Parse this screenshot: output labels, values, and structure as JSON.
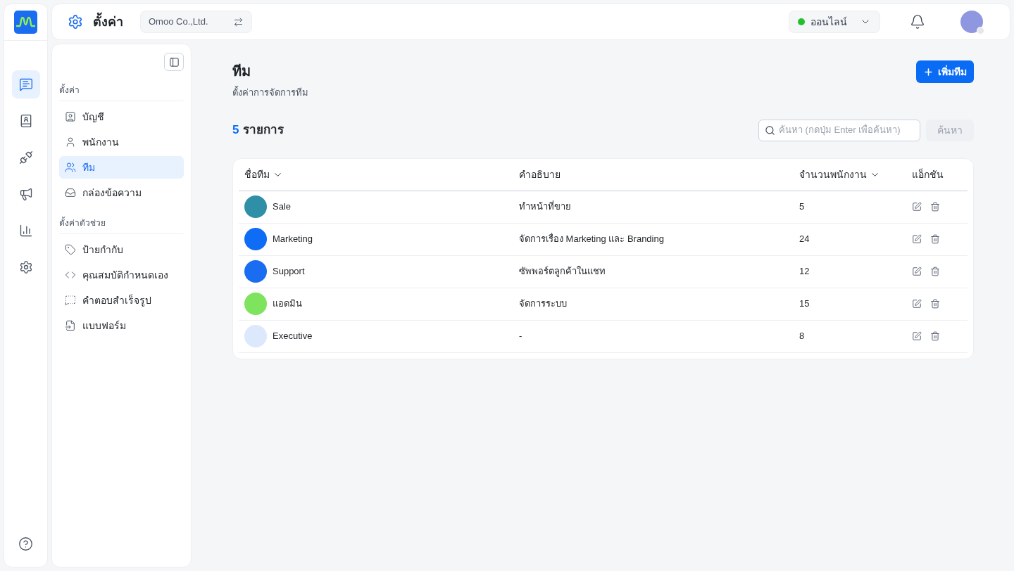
{
  "rail": {
    "items": [
      {
        "kind": "chat",
        "selected": true
      },
      {
        "kind": "contacts",
        "selected": false
      },
      {
        "kind": "integrations",
        "selected": false
      },
      {
        "kind": "broadcast",
        "selected": false
      },
      {
        "kind": "reports",
        "selected": false
      },
      {
        "kind": "settings",
        "selected": false
      }
    ]
  },
  "header": {
    "title": "ตั้งค่า",
    "company": "Omoo Co.,Ltd.",
    "status": {
      "label": "ออนไลน์",
      "color": "#22c02b"
    }
  },
  "sidebar": {
    "sections": [
      {
        "title": "ตั้งค่า",
        "items": [
          {
            "kind": "account",
            "label": "บัญชี",
            "selected": false
          },
          {
            "kind": "staff",
            "label": "พนักงาน",
            "selected": false
          },
          {
            "kind": "team",
            "label": "ทีม",
            "selected": true
          },
          {
            "kind": "inbox",
            "label": "กล่องข้อความ",
            "selected": false
          }
        ]
      },
      {
        "title": "ตั้งค่าตัวช่วย",
        "items": [
          {
            "kind": "tag",
            "label": "ป้ายกำกับ",
            "selected": false
          },
          {
            "kind": "code",
            "label": "คุณสมบัติกำหนดเอง",
            "selected": false
          },
          {
            "kind": "reply",
            "label": "คำตอบสำเร็จรูป",
            "selected": false
          },
          {
            "kind": "form",
            "label": "แบบฟอร์ม",
            "selected": false
          }
        ]
      }
    ]
  },
  "page": {
    "title": "ทีม",
    "subtitle": "ตั้งค่าการจัดการทีม",
    "add_button": "เพิ่มทีม",
    "count": "5",
    "count_label": "รายการ",
    "search": {
      "placeholder": "ค้นหา (กดปุ่ม Enter เพื่อค้นหา)",
      "button": "ค้นหา"
    }
  },
  "table": {
    "columns": [
      {
        "label": "ชื่อทีม",
        "sortable": true
      },
      {
        "label": "คำอธิบาย",
        "sortable": false
      },
      {
        "label": "จำนวนพนักงาน",
        "sortable": true
      },
      {
        "label": "แอ็กชัน",
        "sortable": false
      }
    ],
    "rows": [
      {
        "name": "Sale",
        "description": "ทำหน้าที่ขาย",
        "members": "5",
        "color": "#2e8fa6"
      },
      {
        "name": "Marketing",
        "description": "จัดการเรื่อง Marketing และ Branding",
        "members": "24",
        "color": "#0f6cf5"
      },
      {
        "name": "Support",
        "description": "ซัพพอร์ตลูกค้าในแชท",
        "members": "12",
        "color": "#1a6cf0"
      },
      {
        "name": "แอดมิน",
        "description": "จัดการระบบ",
        "members": "15",
        "color": "#7ee35d"
      },
      {
        "name": "Executive",
        "description": "-",
        "members": "8",
        "color": "#dce8fb"
      }
    ]
  }
}
